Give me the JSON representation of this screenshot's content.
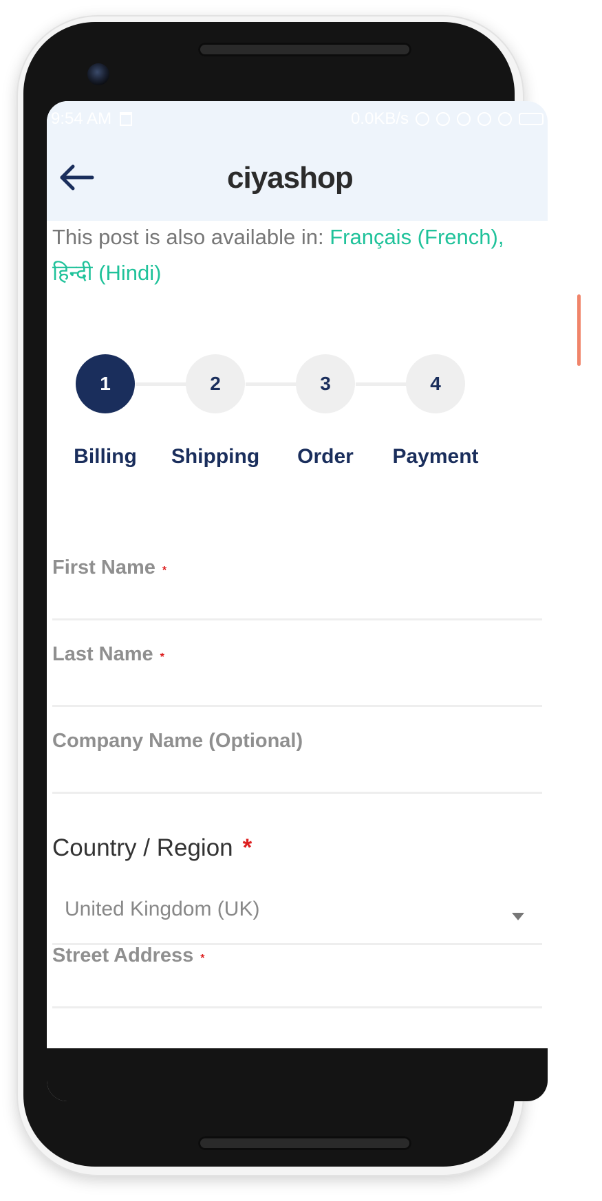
{
  "status_bar": {
    "time": "9:54 AM",
    "network_speed": "0.0KB/s"
  },
  "header": {
    "logo_text": "ciyashop",
    "back_icon": "arrow-left-icon"
  },
  "language_note": {
    "prefix": "This post is also available in: ",
    "languages": [
      "Français (French),",
      "हिन्दी (Hindi)"
    ]
  },
  "stepper": {
    "steps": [
      {
        "number": "1",
        "label": "Billing",
        "active": true
      },
      {
        "number": "2",
        "label": "Shipping",
        "active": false
      },
      {
        "number": "3",
        "label": "Order",
        "active": false
      },
      {
        "number": "4",
        "label": "Payment",
        "active": false
      }
    ]
  },
  "form": {
    "first_name": {
      "label": "First Name",
      "required": "*"
    },
    "last_name": {
      "label": "Last Name",
      "required": "*"
    },
    "company_name": {
      "label": "Company Name (Optional)"
    },
    "country": {
      "label": "Country / Region",
      "required": "*",
      "selected": "United Kingdom (UK)"
    },
    "street_address": {
      "label": "Street Address",
      "required": "*"
    }
  },
  "colors": {
    "primary": "#1a2e5c",
    "accent": "#1fc29a",
    "required": "#dd1f1f",
    "header_bg": "#eef4fb"
  }
}
